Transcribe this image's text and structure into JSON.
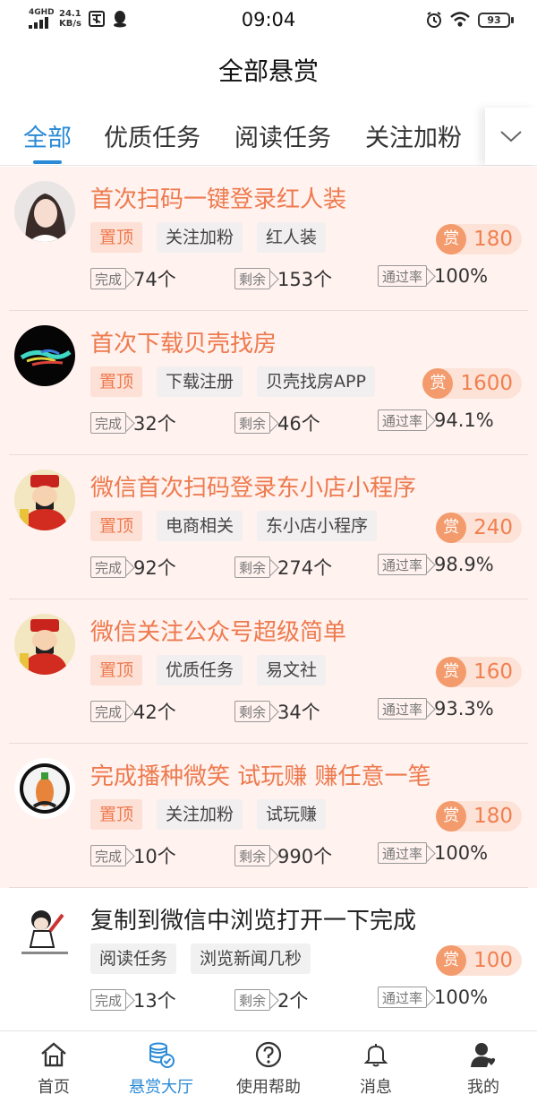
{
  "status_bar": {
    "network": "4GHD",
    "speed_value": "24.1",
    "speed_unit": "KB/s",
    "time": "09:04",
    "battery": "93"
  },
  "page_title": "全部悬赏",
  "tabs": [
    "全部",
    "优质任务",
    "阅读任务",
    "关注加粉"
  ],
  "stat_labels": {
    "done": "完成",
    "remaining": "剩余",
    "pass_rate": "通过率"
  },
  "tasks": [
    {
      "title": "首次扫码一键登录红人装",
      "pinned": true,
      "tags": [
        "置顶",
        "关注加粉",
        "红人装"
      ],
      "reward_icon": "赏",
      "reward": "180",
      "done": "74个",
      "remaining": "153个",
      "pass_rate": "100%"
    },
    {
      "title": "首次下载贝壳找房",
      "pinned": true,
      "tags": [
        "置顶",
        "下载注册",
        "贝壳找房APP"
      ],
      "reward_icon": "赏",
      "reward": "1600",
      "done": "32个",
      "remaining": "46个",
      "pass_rate": "94.1%"
    },
    {
      "title": "微信首次扫码登录东小店小程序",
      "pinned": true,
      "tags": [
        "置顶",
        "电商相关",
        "东小店小程序"
      ],
      "reward_icon": "赏",
      "reward": "240",
      "done": "92个",
      "remaining": "274个",
      "pass_rate": "98.9%"
    },
    {
      "title": "微信关注公众号超级简单",
      "pinned": true,
      "tags": [
        "置顶",
        "优质任务",
        "易文社"
      ],
      "reward_icon": "赏",
      "reward": "160",
      "done": "42个",
      "remaining": "34个",
      "pass_rate": "93.3%"
    },
    {
      "title": "完成播种微笑 试玩赚 赚任意一笔",
      "pinned": true,
      "tags": [
        "置顶",
        "关注加粉",
        "试玩赚"
      ],
      "reward_icon": "赏",
      "reward": "180",
      "done": "10个",
      "remaining": "990个",
      "pass_rate": "100%"
    },
    {
      "title": "复制到微信中浏览打开一下完成",
      "pinned": false,
      "tags": [
        "阅读任务",
        "浏览新闻几秒"
      ],
      "reward_icon": "赏",
      "reward": "100",
      "done": "13个",
      "remaining": "2个",
      "pass_rate": "100%"
    }
  ],
  "bottom_nav": [
    {
      "label": "首页",
      "icon": "home-icon"
    },
    {
      "label": "悬赏大厅",
      "icon": "reward-hall-icon",
      "active": true
    },
    {
      "label": "使用帮助",
      "icon": "help-icon"
    },
    {
      "label": "消息",
      "icon": "bell-icon"
    },
    {
      "label": "我的",
      "icon": "profile-icon"
    }
  ],
  "colors": {
    "accent": "#2a8ad6",
    "reward": "#f08050",
    "pinned_bg": "#fff2ef"
  }
}
